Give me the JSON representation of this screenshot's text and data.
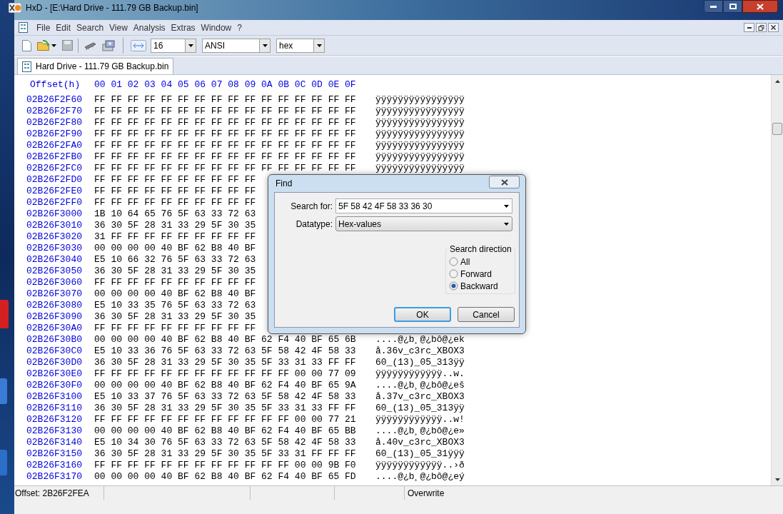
{
  "window": {
    "title": "HxD - [E:\\Hard Drive - 111.79 GB Backup.bin]"
  },
  "menu": [
    "File",
    "Edit",
    "Search",
    "View",
    "Analysis",
    "Extras",
    "Window",
    "?"
  ],
  "toolbar": {
    "bytes_per_row": "16",
    "charset": "ANSI",
    "offset_base": "hex"
  },
  "tabs": [
    {
      "label": "Hard Drive - 111.79 GB Backup.bin",
      "selected": true
    }
  ],
  "editor": {
    "offset_header": "Offset(h)",
    "column_header": "00 01 02 03 04 05 06 07 08 09 0A 0B 0C 0D 0E 0F",
    "rows": [
      {
        "offset": "02B26F2F60",
        "hex": "FF FF FF FF FF FF FF FF FF FF FF FF FF FF FF FF",
        "ascii": "ÿÿÿÿÿÿÿÿÿÿÿÿÿÿÿÿ"
      },
      {
        "offset": "02B26F2F70",
        "hex": "FF FF FF FF FF FF FF FF FF FF FF FF FF FF FF FF",
        "ascii": "ÿÿÿÿÿÿÿÿÿÿÿÿÿÿÿÿ"
      },
      {
        "offset": "02B26F2F80",
        "hex": "FF FF FF FF FF FF FF FF FF FF FF FF FF FF FF FF",
        "ascii": "ÿÿÿÿÿÿÿÿÿÿÿÿÿÿÿÿ"
      },
      {
        "offset": "02B26F2F90",
        "hex": "FF FF FF FF FF FF FF FF FF FF FF FF FF FF FF FF",
        "ascii": "ÿÿÿÿÿÿÿÿÿÿÿÿÿÿÿÿ"
      },
      {
        "offset": "02B26F2FA0",
        "hex": "FF FF FF FF FF FF FF FF FF FF FF FF FF FF FF FF",
        "ascii": "ÿÿÿÿÿÿÿÿÿÿÿÿÿÿÿÿ"
      },
      {
        "offset": "02B26F2FB0",
        "hex": "FF FF FF FF FF FF FF FF FF FF FF FF FF FF FF FF",
        "ascii": "ÿÿÿÿÿÿÿÿÿÿÿÿÿÿÿÿ"
      },
      {
        "offset": "02B26F2FC0",
        "hex": "FF FF FF FF FF FF FF FF FF FF FF FF FF FF FF FF",
        "ascii": "ÿÿÿÿÿÿÿÿÿÿÿÿÿÿÿÿ"
      },
      {
        "offset": "02B26F2FD0",
        "hex": "FF FF FF FF FF FF FF FF FF FF"
      },
      {
        "offset": "02B26F2FE0",
        "hex": "FF FF FF FF FF FF FF FF FF FF"
      },
      {
        "offset": "02B26F2FF0",
        "hex": "FF FF FF FF FF FF FF FF FF FF"
      },
      {
        "offset": "02B26F3000",
        "hex": "1B 10 64 65 76 5F 63 33 72 63"
      },
      {
        "offset": "02B26F3010",
        "hex": "36 30 5F 28 31 33 29 5F 30 35"
      },
      {
        "offset": "02B26F3020",
        "hex": "31 FF FF FF FF FF FF FF FF FF"
      },
      {
        "offset": "02B26F3030",
        "hex": "00 00 00 00 40 BF 62 B8 40 BF"
      },
      {
        "offset": "02B26F3040",
        "hex": "E5 10 66 32 76 5F 63 33 72 63"
      },
      {
        "offset": "02B26F3050",
        "hex": "36 30 5F 28 31 33 29 5F 30 35"
      },
      {
        "offset": "02B26F3060",
        "hex": "FF FF FF FF FF FF FF FF FF FF"
      },
      {
        "offset": "02B26F3070",
        "hex": "00 00 00 00 40 BF 62 B8 40 BF"
      },
      {
        "offset": "02B26F3080",
        "hex": "E5 10 33 35 76 5F 63 33 72 63"
      },
      {
        "offset": "02B26F3090",
        "hex": "36 30 5F 28 31 33 29 5F 30 35"
      },
      {
        "offset": "02B26F30A0",
        "hex": "FF FF FF FF FF FF FF FF FF FF"
      },
      {
        "offset": "02B26F30B0",
        "hex": "00 00 00 00 40 BF 62 B8 40 BF 62 F4 40 BF 65 6B",
        "ascii": "....@¿b¸@¿bô@¿ek"
      },
      {
        "offset": "02B26F30C0",
        "hex": "E5 10 33 36 76 5F 63 33 72 63 5F 58 42 4F 58 33",
        "ascii": "å.36v_c3rc_XBOX3"
      },
      {
        "offset": "02B26F30D0",
        "hex": "36 30 5F 28 31 33 29 5F 30 35 5F 33 31 33 FF FF",
        "ascii": "60_(13)_05_313ÿÿ"
      },
      {
        "offset": "02B26F30E0",
        "hex": "FF FF FF FF FF FF FF FF FF FF FF FF 00 00 77 09",
        "ascii": "ÿÿÿÿÿÿÿÿÿÿÿÿ..w."
      },
      {
        "offset": "02B26F30F0",
        "hex": "00 00 00 00 40 BF 62 B8 40 BF 62 F4 40 BF 65 9A",
        "ascii": "....@¿b¸@¿bô@¿eš"
      },
      {
        "offset": "02B26F3100",
        "hex": "E5 10 33 37 76 5F 63 33 72 63 5F 58 42 4F 58 33",
        "ascii": "å.37v_c3rc_XBOX3"
      },
      {
        "offset": "02B26F3110",
        "hex": "36 30 5F 28 31 33 29 5F 30 35 5F 33 31 33 FF FF",
        "ascii": "60_(13)_05_313ÿÿ"
      },
      {
        "offset": "02B26F3120",
        "hex": "FF FF FF FF FF FF FF FF FF FF FF FF 00 00 77 21",
        "ascii": "ÿÿÿÿÿÿÿÿÿÿÿÿ..w!"
      },
      {
        "offset": "02B26F3130",
        "hex": "00 00 00 00 40 BF 62 B8 40 BF 62 F4 40 BF 65 BB",
        "ascii": "....@¿b¸@¿bô@¿e»"
      },
      {
        "offset": "02B26F3140",
        "hex": "E5 10 34 30 76 5F 63 33 72 63 5F 58 42 4F 58 33",
        "ascii": "å.40v_c3rc_XBOX3"
      },
      {
        "offset": "02B26F3150",
        "hex": "36 30 5F 28 31 33 29 5F 30 35 5F 33 31 FF FF FF",
        "ascii": "60_(13)_05_31ÿÿÿ"
      },
      {
        "offset": "02B26F3160",
        "hex": "FF FF FF FF FF FF FF FF FF FF FF FF 00 00 9B F0",
        "ascii": "ÿÿÿÿÿÿÿÿÿÿÿÿ..›ð"
      },
      {
        "offset": "02B26F3170",
        "hex": "00 00 00 00 40 BF 62 B8 40 BF 62 F4 40 BF 65 FD",
        "ascii": "....@¿b¸@¿bô@¿eý"
      }
    ]
  },
  "find_dialog": {
    "title": "Find",
    "search_for": {
      "label": "Search for:",
      "value": "5F 58 42 4F 58 33 36 30"
    },
    "datatype": {
      "label": "Datatype:",
      "value": "Hex-values"
    },
    "direction": {
      "title": "Search direction",
      "options": [
        {
          "label": "All",
          "selected": false
        },
        {
          "label": "Forward",
          "selected": false
        },
        {
          "label": "Backward",
          "selected": true
        }
      ]
    },
    "buttons": [
      {
        "label": "OK",
        "default": true
      },
      {
        "label": "Cancel",
        "default": false
      }
    ]
  },
  "status_bar": {
    "offset": "Offset: 2B26F2FEA",
    "mode": "Overwrite"
  }
}
